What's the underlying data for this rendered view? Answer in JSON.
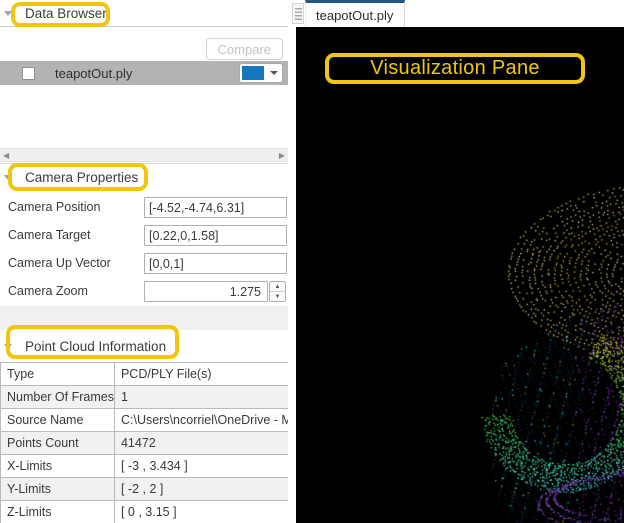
{
  "colors": {
    "annotation_highlight": "#f0c70e",
    "file_swatch_blue": "#1578be",
    "tab_accent": "#25567b",
    "viz_background": "#000000",
    "selected_row_gray": "#b3b3b3"
  },
  "data_browser": {
    "header": "Data Browser",
    "compare_button": "Compare",
    "file_item": {
      "label": "teapotOut.ply",
      "checked": false,
      "swatch_color": "#1578be"
    }
  },
  "camera_properties": {
    "header": "Camera Properties",
    "fields": [
      {
        "label": "Camera Position",
        "value": "[-4.52,-4.74,6.31]"
      },
      {
        "label": "Camera Target",
        "value": "[0.22,0,1.58]"
      },
      {
        "label": "Camera Up Vector",
        "value": "[0,0,1]"
      },
      {
        "label": "Camera Zoom",
        "value": "1.275"
      }
    ]
  },
  "point_cloud_information": {
    "header": "Point Cloud Information",
    "rows": [
      {
        "label": "Type",
        "value": "PCD/PLY File(s)"
      },
      {
        "label": "Number Of Frames",
        "value": "1"
      },
      {
        "label": "Source Name",
        "value": "C:\\Users\\ncorriel\\OneDrive - Ma"
      },
      {
        "label": "Points Count",
        "value": "41472"
      },
      {
        "label": "X-Limits",
        "value": "[ -3 , 3.434 ]"
      },
      {
        "label": "Y-Limits",
        "value": "[ -2 , 2 ]"
      },
      {
        "label": "Z-Limits",
        "value": "[ 0 , 3.15 ]"
      }
    ]
  },
  "visualization": {
    "tab_label": "teapotOut.ply",
    "annotation_label": "Visualization Pane",
    "point_cloud": {
      "object": "teapot",
      "colormap": [
        "#d9c94b",
        "#8cd468",
        "#3bd9c2",
        "#2b4fc0",
        "#9a4fd6"
      ]
    }
  }
}
